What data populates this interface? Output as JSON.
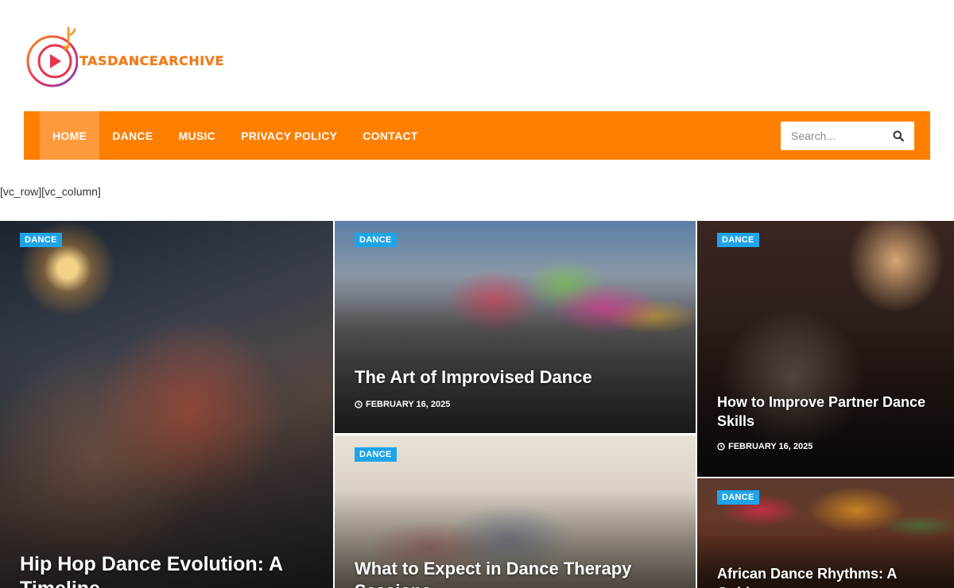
{
  "site": {
    "logo_text": "TASDANCEARCHIVE"
  },
  "nav": {
    "items": [
      {
        "label": "HOME",
        "active": true
      },
      {
        "label": "DANCE",
        "active": false
      },
      {
        "label": "MUSIC",
        "active": false
      },
      {
        "label": "PRIVACY POLICY",
        "active": false
      },
      {
        "label": "CONTACT",
        "active": false
      }
    ],
    "search_placeholder": "Search..."
  },
  "shortcode_text": "[vc_row][vc_column]",
  "colors": {
    "nav_bg": "#ff7f00",
    "nav_active": "#ff9a3c",
    "badge": "#1fa4e8"
  },
  "posts": [
    {
      "category": "DANCE",
      "title": "Hip Hop Dance Evolution: A Timeline",
      "date": ""
    },
    {
      "category": "DANCE",
      "title": "The Art of Improvised Dance",
      "date": "FEBRUARY 16, 2025"
    },
    {
      "category": "DANCE",
      "title": "What to Expect in Dance Therapy Sessions",
      "date": ""
    },
    {
      "category": "DANCE",
      "title": "How to Improve Partner Dance Skills",
      "date": "FEBRUARY 16, 2025"
    },
    {
      "category": "DANCE",
      "title": "African Dance Rhythms: A Guide",
      "date": ""
    }
  ]
}
